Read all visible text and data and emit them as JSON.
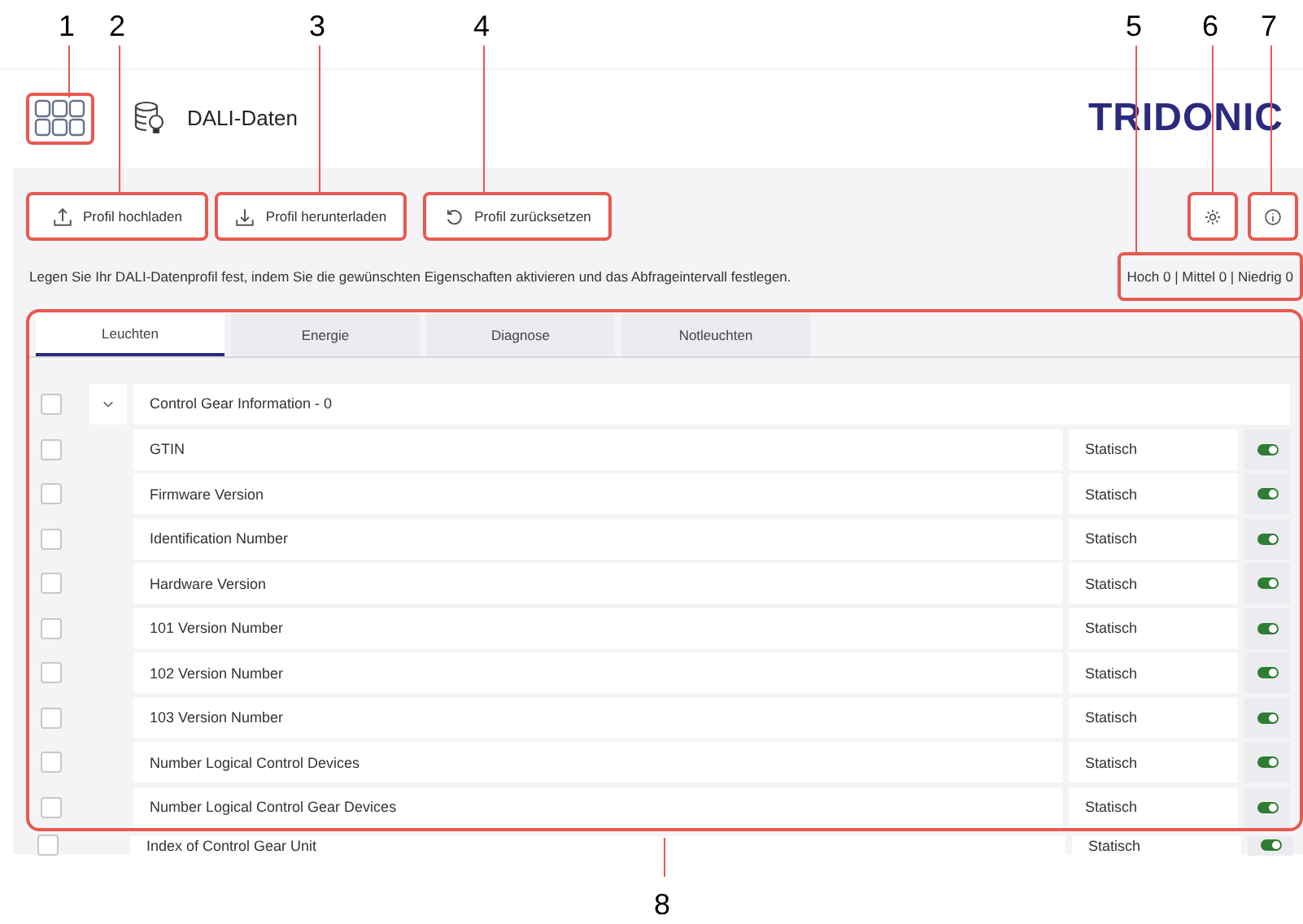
{
  "callouts": [
    {
      "label": "1"
    },
    {
      "label": "2"
    },
    {
      "label": "3"
    },
    {
      "label": "4"
    },
    {
      "label": "5"
    },
    {
      "label": "6"
    },
    {
      "label": "7"
    },
    {
      "label": "8"
    }
  ],
  "header": {
    "title": "DALI-Daten",
    "logo": "TRIDONIC"
  },
  "toolbar": {
    "buttons": [
      {
        "label": "Profil hochladen",
        "kind": "upload"
      },
      {
        "label": "Profil herunterladen",
        "kind": "download"
      },
      {
        "label": "Profil zurücksetzen",
        "kind": "reset"
      }
    ]
  },
  "description": "Legen Sie Ihr DALI-Datenprofil fest, indem Sie die gewünschten Eigenschaften aktivieren und das Abfrageintervall festlegen.",
  "priority_summary": "Hoch 0 | Mittel 0 | Niedrig 0",
  "tabs": [
    {
      "label": "Leuchten",
      "selected": true
    },
    {
      "label": "Energie",
      "selected": false
    },
    {
      "label": "Diagnose",
      "selected": false
    },
    {
      "label": "Notleuchten",
      "selected": false
    }
  ],
  "group": {
    "title": "Control Gear Information - 0",
    "checked": false,
    "expanded": true
  },
  "rows": [
    {
      "name": "GTIN",
      "type": "Statisch",
      "checked": false,
      "on": true
    },
    {
      "name": "Firmware Version",
      "type": "Statisch",
      "checked": false,
      "on": true
    },
    {
      "name": "Identification Number",
      "type": "Statisch",
      "checked": false,
      "on": true
    },
    {
      "name": "Hardware Version",
      "type": "Statisch",
      "checked": false,
      "on": true
    },
    {
      "name": "101 Version Number",
      "type": "Statisch",
      "checked": false,
      "on": true
    },
    {
      "name": "102 Version Number",
      "type": "Statisch",
      "checked": false,
      "on": true
    },
    {
      "name": "103 Version Number",
      "type": "Statisch",
      "checked": false,
      "on": true
    },
    {
      "name": "Number Logical Control Devices",
      "type": "Statisch",
      "checked": false,
      "on": true
    },
    {
      "name": "Number Logical Control Gear Devices",
      "type": "Statisch",
      "checked": false,
      "on": true
    }
  ],
  "cut_row": {
    "name": "Index of Control Gear Unit",
    "type": "Statisch",
    "checked": false,
    "on": true
  }
}
